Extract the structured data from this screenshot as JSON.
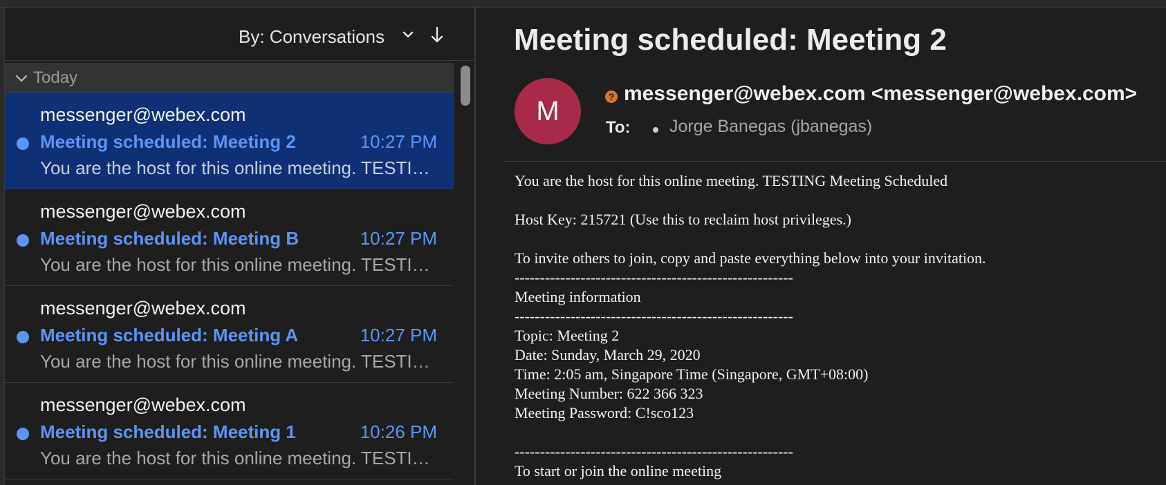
{
  "list": {
    "sort_label": "By: Conversations",
    "group_label": "Today",
    "messages": [
      {
        "sender": "messenger@webex.com",
        "subject": "Meeting scheduled: Meeting 2",
        "time": "10:27 PM",
        "preview": "You are the host for this online meeting. TESTING Meeting Scheduled"
      },
      {
        "sender": "messenger@webex.com",
        "subject": "Meeting scheduled: Meeting B",
        "time": "10:27 PM",
        "preview": "You are the host for this online meeting. TESTING Meeting Scheduled"
      },
      {
        "sender": "messenger@webex.com",
        "subject": "Meeting scheduled: Meeting A",
        "time": "10:27 PM",
        "preview": "You are the host for this online meeting. TESTING Meeting Scheduled"
      },
      {
        "sender": "messenger@webex.com",
        "subject": "Meeting scheduled: Meeting 1",
        "time": "10:26 PM",
        "preview": "You are the host for this online meeting. TESTING Meeting Scheduled"
      }
    ]
  },
  "reading": {
    "subject": "Meeting scheduled: Meeting 2",
    "avatar_initial": "M",
    "warning_glyph": "?",
    "from": "messenger@webex.com <messenger@webex.com>",
    "to_label": "To:",
    "recipient": "Jorge Banegas (jbanegas)",
    "body_lines": [
      "You are the host for this online meeting. TESTING Meeting Scheduled",
      "",
      "Host Key: 215721 (Use this to reclaim host privileges.)",
      "",
      "To invite others to join, copy and paste everything below into your invitation.",
      "-------------------------------------------------------",
      "Meeting information",
      "-------------------------------------------------------",
      "Topic: Meeting 2",
      "Date: Sunday, March 29, 2020",
      "Time: 2:05 am, Singapore Time (Singapore, GMT+08:00)",
      "Meeting Number: 622 366 323",
      "Meeting Password: C!sco123",
      "",
      "-------------------------------------------------------",
      "To start or join the online meeting"
    ]
  },
  "colors": {
    "selected_row": "#0f3076",
    "unread_accent": "#5b95f5",
    "avatar": "#a92a48",
    "warning": "#d9762a"
  },
  "icons": [
    "chevron-down-icon",
    "sort-down-arrow-icon",
    "group-collapse-icon",
    "unread-dot-icon",
    "warning-icon"
  ]
}
